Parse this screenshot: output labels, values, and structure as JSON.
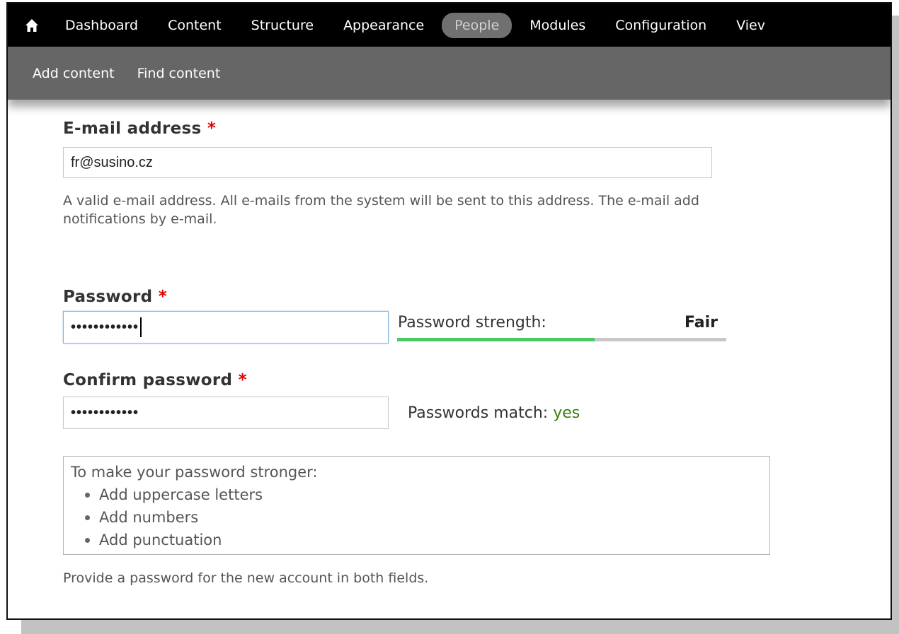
{
  "toolbar": {
    "home_icon": "home-icon",
    "menu": [
      {
        "label": "Dashboard",
        "active": false
      },
      {
        "label": "Content",
        "active": false
      },
      {
        "label": "Structure",
        "active": false
      },
      {
        "label": "Appearance",
        "active": false
      },
      {
        "label": "People",
        "active": true
      },
      {
        "label": "Modules",
        "active": false
      },
      {
        "label": "Configuration",
        "active": false
      },
      {
        "label": "Viev",
        "active": false
      }
    ]
  },
  "shortcuts": [
    {
      "label": "Add content"
    },
    {
      "label": "Find content"
    }
  ],
  "form": {
    "email": {
      "label": "E-mail address",
      "required_marker": "*",
      "value": "fr@susino.cz",
      "description_line1": "A valid e-mail address. All e-mails from the system will be sent to this address. The e-mail add",
      "description_line2": "notifications by e-mail."
    },
    "password": {
      "label": "Password",
      "required_marker": "*",
      "masked_value": "••••••••••••",
      "strength_label": "Password strength:",
      "strength_value": "Fair",
      "strength_fraction": 0.6
    },
    "confirm_password": {
      "label": "Confirm password",
      "required_marker": "*",
      "masked_value": "••••••••••••",
      "match_label": "Passwords match:",
      "match_value": "yes"
    },
    "suggestions": {
      "title": "To make your password stronger:",
      "items": [
        "Add uppercase letters",
        "Add numbers",
        "Add punctuation"
      ]
    },
    "help_text": "Provide a password for the new account in both fields."
  },
  "colors": {
    "toolbar_bg": "#000000",
    "shortcut_bg": "#666666",
    "required": "#e00000",
    "strength_fill": "#47c965",
    "match_yes": "#3b7d15"
  }
}
